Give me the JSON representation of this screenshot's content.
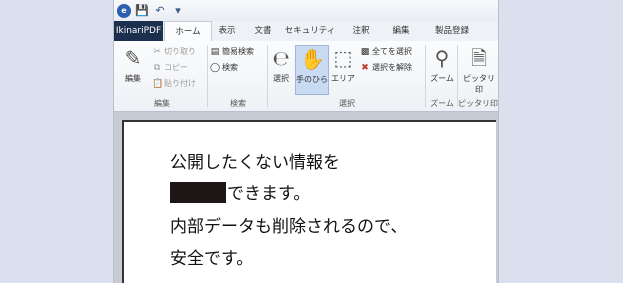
{
  "quick_access": {
    "icons": [
      "app-icon",
      "save-icon",
      "undo-icon",
      "dropdown-icon"
    ]
  },
  "tabs": {
    "file": "IkinariPDF",
    "items": [
      "ホーム",
      "表示",
      "文書",
      "セキュリティ",
      "注釈",
      "編集",
      "製品登録"
    ],
    "active": "ホーム"
  },
  "ribbon": {
    "edit_group": {
      "label": "編集",
      "big_button": "編集",
      "copy_cut": "切り取り",
      "copy": "コピー",
      "paste": "貼り付け"
    },
    "search_group": {
      "label": "検索",
      "advanced_search": "簡易検索",
      "search": "検索"
    },
    "select_group": {
      "label": "選択",
      "select": "選択",
      "hand": "手のひら",
      "area": "エリア",
      "select_all": "全てを選択",
      "deselect": "選択を解除"
    },
    "zoom_group": {
      "label": "ズーム",
      "zoom": "ズーム"
    },
    "fit_group": {
      "label": "ピッタリ印",
      "fit": "ピッタリ印"
    }
  },
  "document": {
    "lines": [
      "公開したくない情報を",
      "できます。",
      "内部データも削除されるので、",
      "安全です。"
    ]
  }
}
